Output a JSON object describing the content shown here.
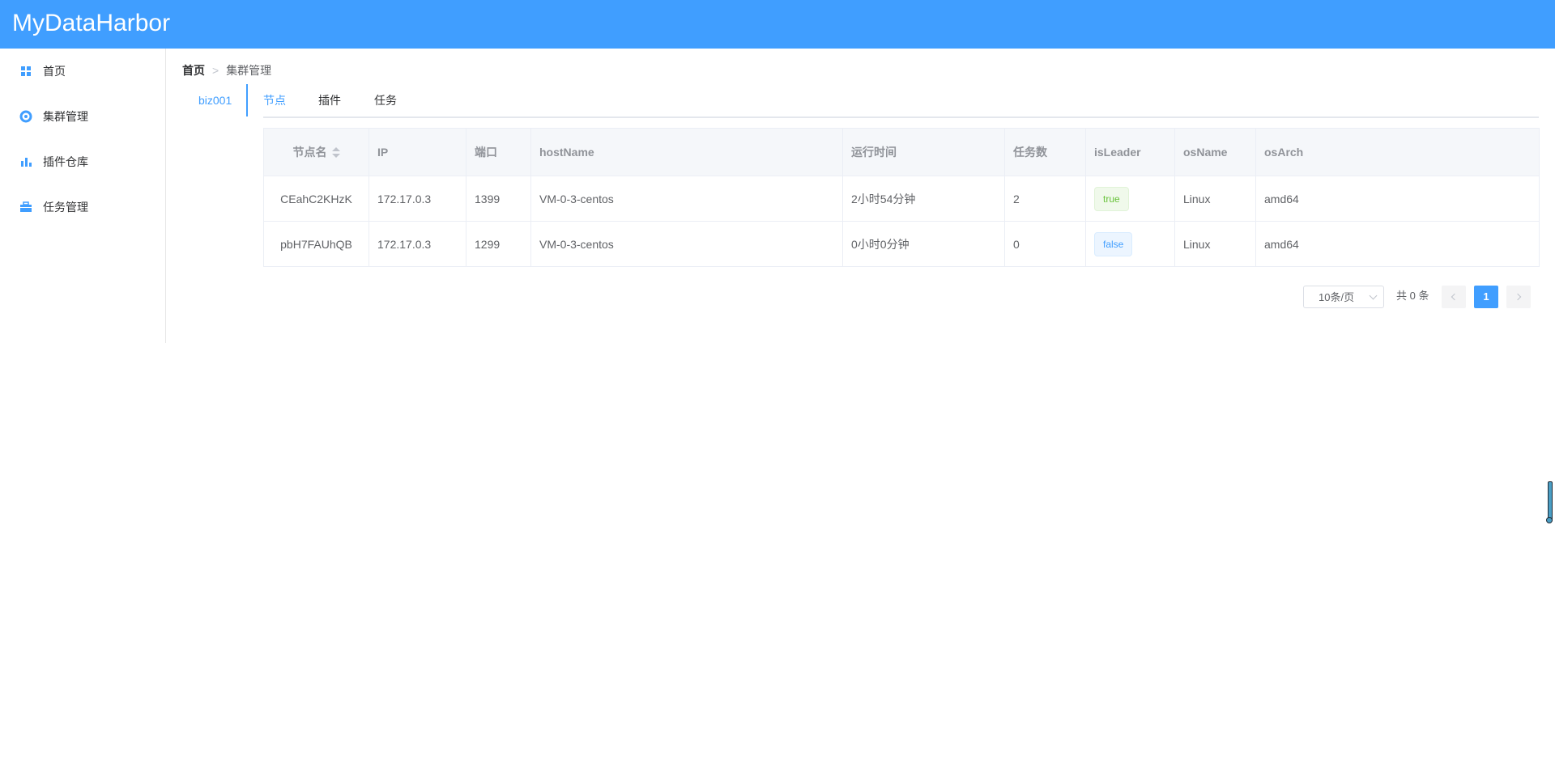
{
  "app": {
    "title": "MyDataHarbor"
  },
  "sidebar": {
    "items": [
      {
        "label": "首页",
        "icon": "grid-icon"
      },
      {
        "label": "集群管理",
        "icon": "cluster-icon"
      },
      {
        "label": "插件仓库",
        "icon": "bar-chart-icon"
      },
      {
        "label": "任务管理",
        "icon": "briefcase-icon"
      }
    ]
  },
  "breadcrumb": {
    "home": "首页",
    "separator": ">",
    "current": "集群管理"
  },
  "cluster_tab": {
    "label": "biz001"
  },
  "tabs": [
    {
      "label": "节点",
      "active": true
    },
    {
      "label": "插件",
      "active": false
    },
    {
      "label": "任务",
      "active": false
    }
  ],
  "table": {
    "columns": [
      "节点名",
      "IP",
      "端口",
      "hostName",
      "运行时间",
      "任务数",
      "isLeader",
      "osName",
      "osArch"
    ],
    "rows": [
      {
        "name": "CEahC2KHzK",
        "ip": "172.17.0.3",
        "port": "1399",
        "host": "VM-0-3-centos",
        "uptime": "2小时54分钟",
        "tasks": "2",
        "leader": "true",
        "os": "Linux",
        "arch": "amd64"
      },
      {
        "name": "pbH7FAUhQB",
        "ip": "172.17.0.3",
        "port": "1299",
        "host": "VM-0-3-centos",
        "uptime": "0小时0分钟",
        "tasks": "0",
        "leader": "false",
        "os": "Linux",
        "arch": "amd64"
      }
    ]
  },
  "pagination": {
    "page_size": "10条/页",
    "total": "共 0 条",
    "current_page": "1"
  },
  "colors": {
    "primary": "#409eff",
    "success": "#67c23a"
  }
}
